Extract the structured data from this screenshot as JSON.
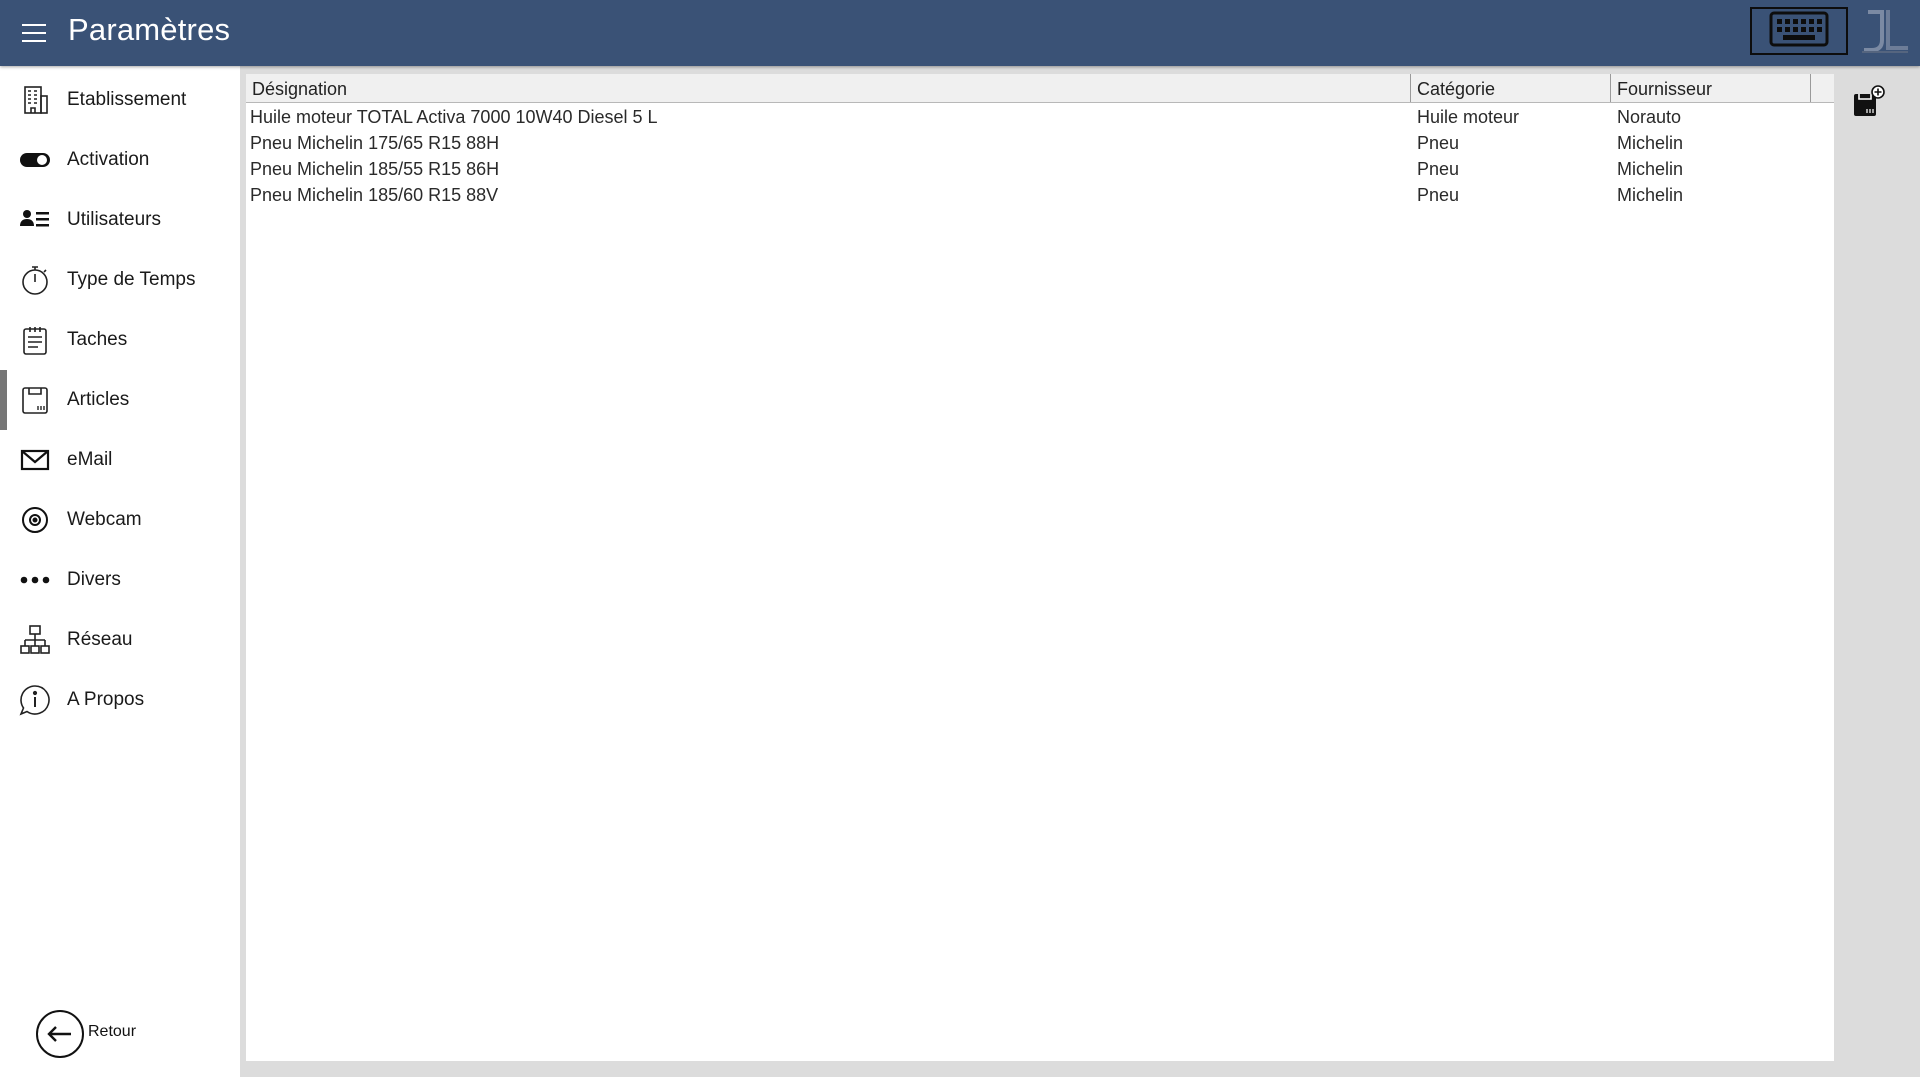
{
  "header": {
    "title": "Paramètres",
    "menu_icon": "hamburger-menu-icon",
    "keyboard_icon": "keyboard-icon",
    "logo": "JL",
    "bar_color": "#3a5276"
  },
  "sidebar": {
    "items": [
      {
        "label": "Etablissement",
        "icon": "building-icon"
      },
      {
        "label": "Activation",
        "icon": "toggle-switch-icon"
      },
      {
        "label": "Utilisateurs",
        "icon": "users-list-icon"
      },
      {
        "label": "Type de Temps",
        "icon": "stopwatch-icon"
      },
      {
        "label": "Taches",
        "icon": "clipboard-list-icon"
      },
      {
        "label": "Articles",
        "icon": "article-box-icon",
        "selected": true
      },
      {
        "label": "eMail",
        "icon": "envelope-icon"
      },
      {
        "label": "Webcam",
        "icon": "webcam-icon"
      },
      {
        "label": "Divers",
        "icon": "more-dots-icon"
      },
      {
        "label": "Réseau",
        "icon": "network-icon"
      },
      {
        "label": "A Propos",
        "icon": "info-bubble-icon"
      }
    ],
    "back": {
      "label": "Retour",
      "icon": "arrow-left-icon"
    }
  },
  "table": {
    "columns": [
      "Désignation",
      "Catégorie",
      "Fournisseur"
    ],
    "rows": [
      [
        "Huile moteur TOTAL Activa 7000 10W40 Diesel 5 L",
        "Huile moteur",
        "Norauto"
      ],
      [
        "Pneu Michelin 175/65 R15 88H",
        "Pneu",
        "Michelin"
      ],
      [
        "Pneu Michelin 185/55 R15 86H",
        "Pneu",
        "Michelin"
      ],
      [
        "Pneu Michelin 185/60 R15 88V",
        "Pneu",
        "Michelin"
      ]
    ]
  },
  "actions": {
    "add_article_icon": "add-article-icon"
  }
}
